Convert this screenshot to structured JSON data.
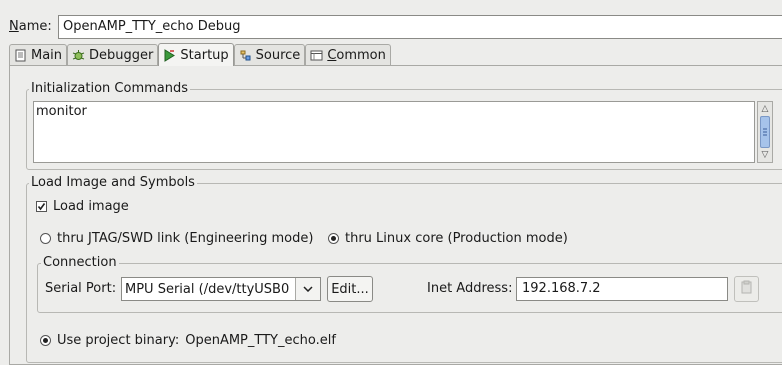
{
  "name": {
    "label_underlined": "N",
    "label_rest": "ame:",
    "value": "OpenAMP_TTY_echo Debug"
  },
  "tabs": [
    {
      "label": "Main",
      "icon": "document-icon"
    },
    {
      "label": "Debugger",
      "icon": "bug-icon"
    },
    {
      "label": "Startup",
      "icon": "startup-icon",
      "active": true
    },
    {
      "label": "Source",
      "icon": "source-icon"
    },
    {
      "label_underlined": "C",
      "label_rest": "ommon",
      "icon": "common-icon"
    }
  ],
  "init_commands": {
    "title": "Initialization Commands",
    "text": "monitor"
  },
  "load": {
    "title": "Load Image and Symbols",
    "load_image_label": "Load image",
    "load_image_checked": true,
    "radio_jtag_label": "thru JTAG/SWD link (Engineering mode)",
    "radio_linux_label": "thru Linux core (Production mode)",
    "selected_mode": "linux",
    "connection": {
      "title": "Connection",
      "serial_port_label": "Serial Port:",
      "serial_port_value": "MPU Serial (/dev/ttyUSB0",
      "edit_label": "Edit...",
      "inet_label": "Inet Address:",
      "inet_value": "192.168.7.2"
    },
    "use_binary_label": "Use project binary:",
    "binary_name": "OpenAMP_TTY_echo.elf"
  }
}
